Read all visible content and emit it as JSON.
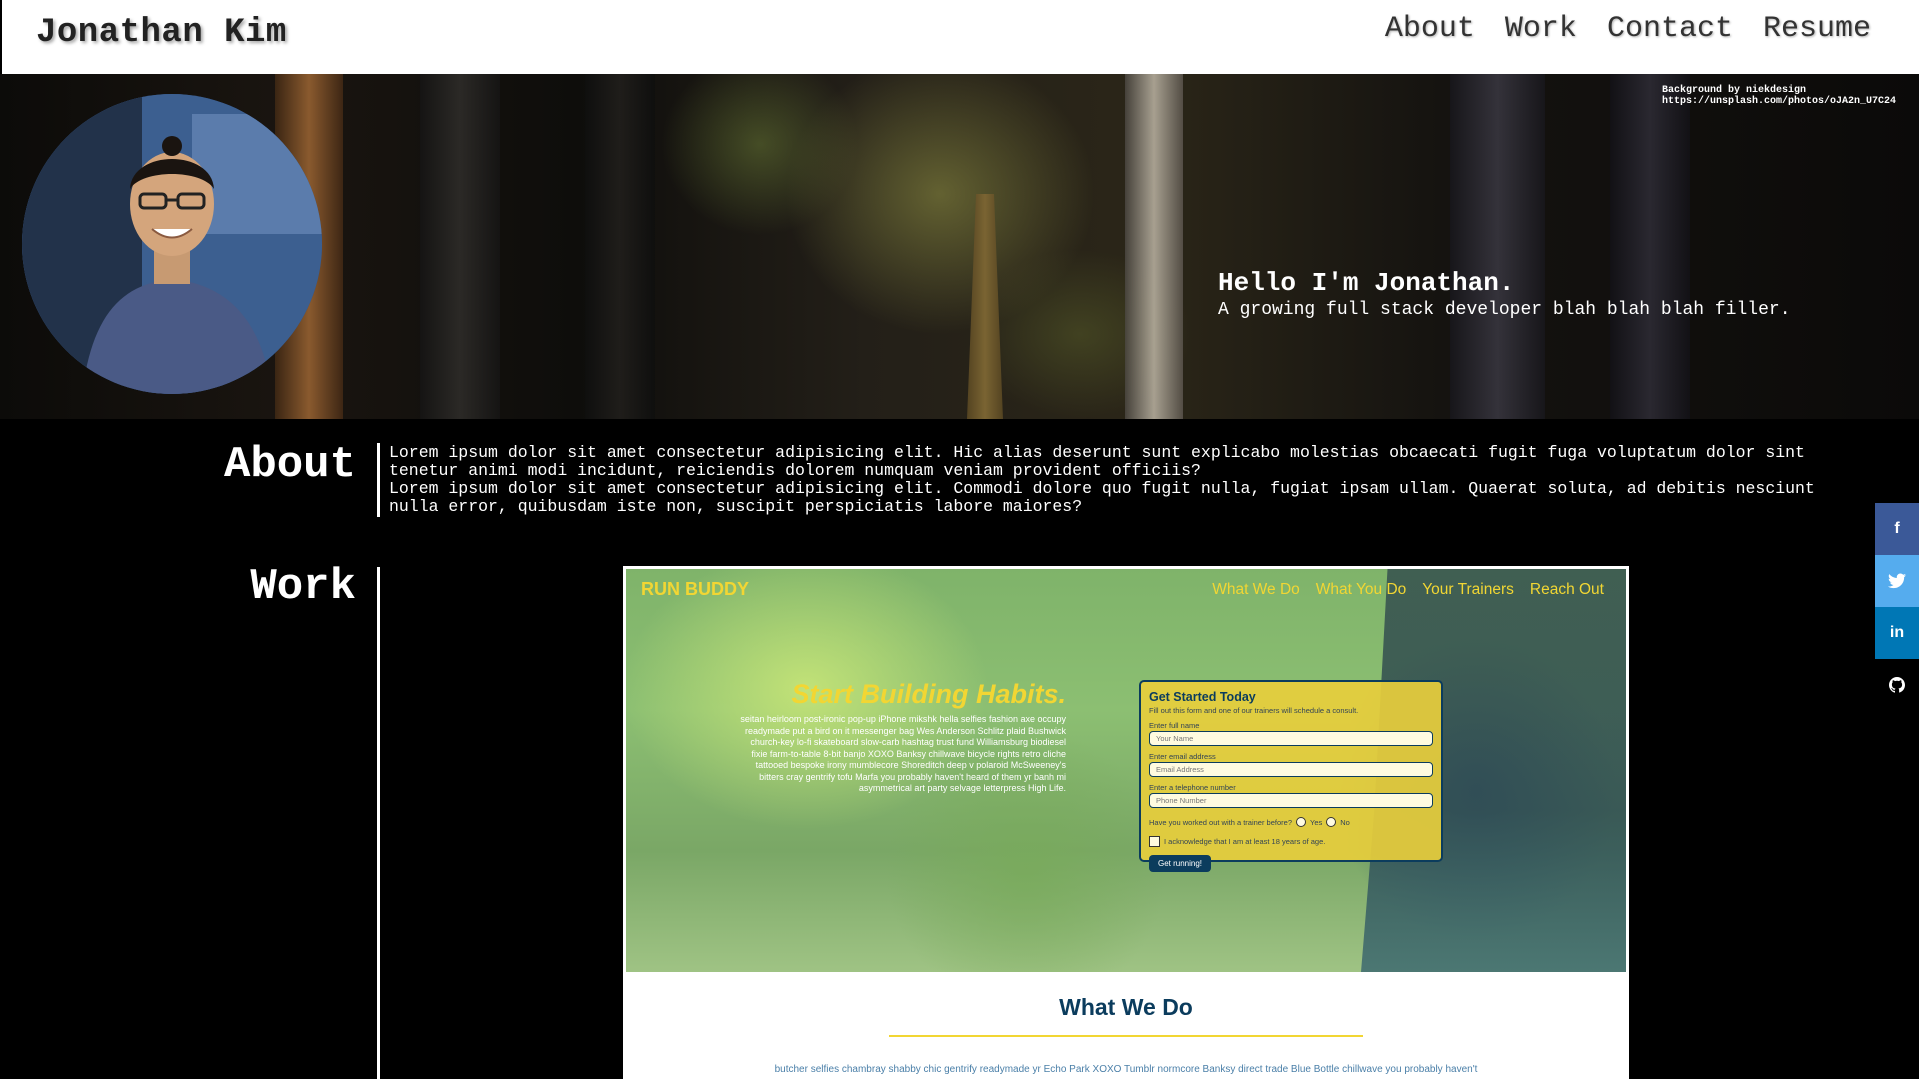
{
  "header": {
    "brand": "Jonathan Kim",
    "nav": [
      "About",
      "Work",
      "Contact",
      "Resume"
    ]
  },
  "hero": {
    "credit_line1": "Background by niekdesign",
    "credit_line2": "https://unsplash.com/photos/oJA2n_U7C24",
    "greeting": "Hello I'm Jonathan.",
    "tagline": "A growing full stack developer blah blah blah filler."
  },
  "about": {
    "title": "About",
    "paragraph1": "Lorem ipsum dolor sit amet consectetur adipisicing elit. Hic alias deserunt sunt explicabo molestias obcaecati fugit fuga voluptatum dolor sint tenetur animi modi incidunt, reiciendis dolorem numquam veniam provident officiis?",
    "paragraph2": "Lorem ipsum dolor sit amet consectetur adipisicing elit. Commodi dolore quo fugit nulla, fugiat ipsam ullam. Quaerat soluta, ad debitis nesciunt nulla error, quibusdam iste non, suscipit perspiciatis labore maiores?"
  },
  "work": {
    "title": "Work",
    "project": {
      "brand": "RUN BUDDY",
      "nav": [
        "What We Do",
        "What You Do",
        "Your Trainers",
        "Reach Out"
      ],
      "headline": "Start Building Habits.",
      "intro": "seitan heirloom post-ironic pop-up iPhone mikshk hella selfies fashion axe occupy readymade put a bird on it messenger bag Wes Anderson Schlitz plaid Bushwick church-key lo-fi skateboard slow-carb hashtag trust fund Williamsburg biodiesel fixie farm-to-table 8-bit banjo XOXO Banksy chillwave bicycle rights retro cliche tattooed bespoke irony mumblecore Shoreditch deep v polaroid McSweeney's bitters cray gentrify tofu Marfa you probably haven't heard of them yr banh mi asymmetrical art party selvage letterpress High Life.",
      "form": {
        "title": "Get Started Today",
        "subtitle": "Fill out this form and one of our trainers will schedule a consult.",
        "name_label": "Enter full name",
        "name_placeholder": "Your Name",
        "email_label": "Enter email address",
        "email_placeholder": "Email Address",
        "phone_label": "Enter a telephone number",
        "phone_placeholder": "Phone Number",
        "question": "Have you worked out with a trainer before?",
        "yes": "Yes",
        "no": "No",
        "ack": "I acknowledge that I am at least 18 years of age.",
        "button": "Get running!"
      },
      "section_title": "What We Do",
      "section_text": "butcher selfies chambray shabby chic gentrify readymade yr Echo Park XOXO Tumblr normcore Banksy direct trade Blue Bottle chillwave you probably haven't"
    }
  },
  "social": {
    "facebook": "f",
    "twitter": "🐦",
    "linkedin": "in",
    "github": "●"
  }
}
